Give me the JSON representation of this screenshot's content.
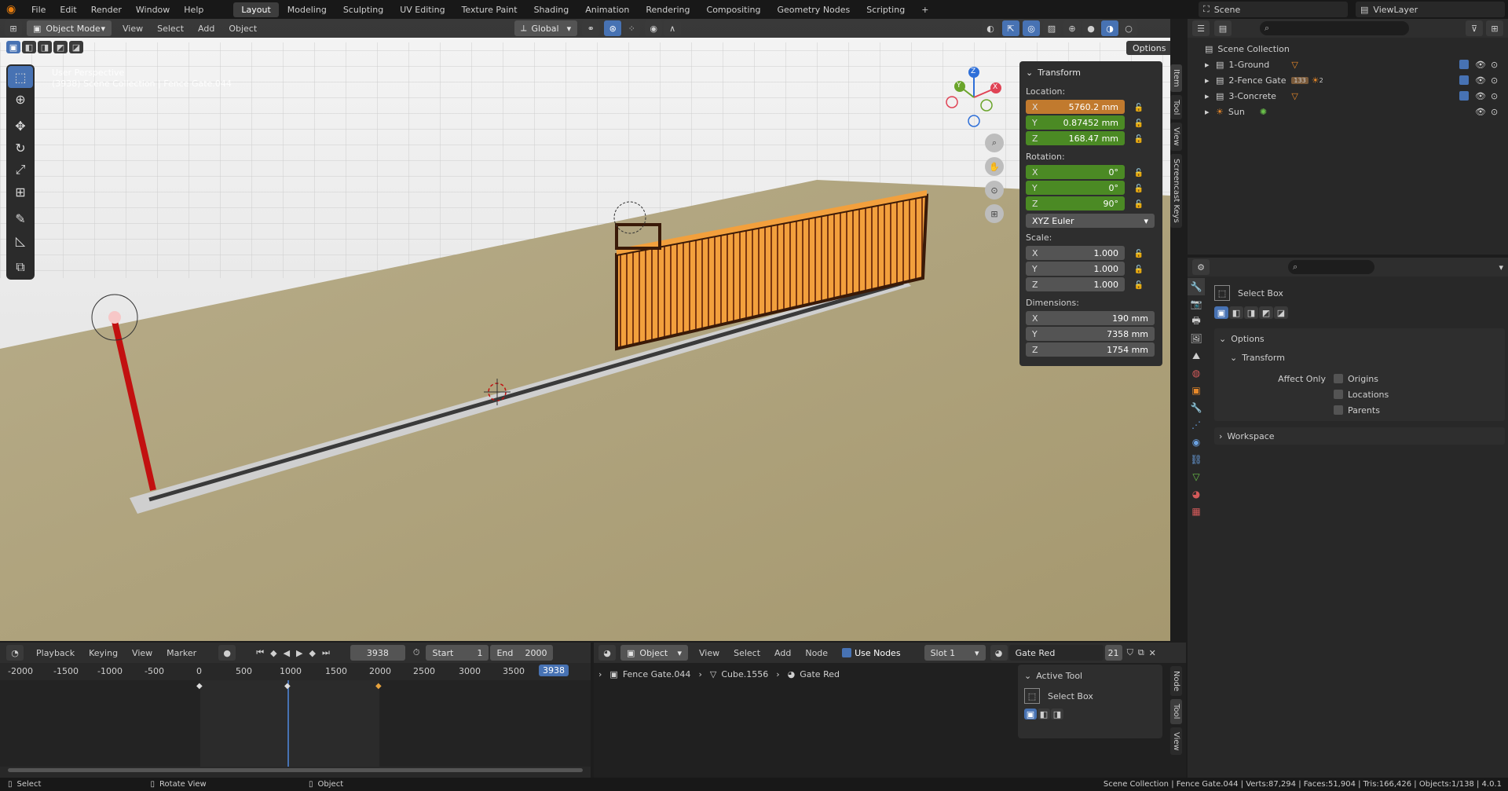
{
  "topbar": {
    "menus": [
      "File",
      "Edit",
      "Render",
      "Window",
      "Help"
    ],
    "tabs": [
      "Layout",
      "Modeling",
      "Sculpting",
      "UV Editing",
      "Texture Paint",
      "Shading",
      "Animation",
      "Rendering",
      "Compositing",
      "Geometry Nodes",
      "Scripting"
    ],
    "active_tab": "Layout",
    "add_tab": "+",
    "scene": "Scene",
    "view_layer": "ViewLayer"
  },
  "viewport": {
    "mode": "Object Mode",
    "menus": [
      "View",
      "Select",
      "Add",
      "Object"
    ],
    "orientation": "Global",
    "options": "Options",
    "overlay_line1": "User Perspective",
    "overlay_line2": "(3938) Scene Collection | Fence Gate.044",
    "gizmo": {
      "x": "X",
      "y": "Y",
      "z": "Z"
    }
  },
  "npanel": {
    "title": "Transform",
    "location_label": "Location:",
    "location": [
      {
        "ax": "X",
        "val": "5760.2 mm"
      },
      {
        "ax": "Y",
        "val": "0.87452 mm"
      },
      {
        "ax": "Z",
        "val": "168.47 mm"
      }
    ],
    "rotation_label": "Rotation:",
    "rotation": [
      {
        "ax": "X",
        "val": "0°"
      },
      {
        "ax": "Y",
        "val": "0°"
      },
      {
        "ax": "Z",
        "val": "90°"
      }
    ],
    "rotation_mode": "XYZ Euler",
    "scale_label": "Scale:",
    "scale": [
      {
        "ax": "X",
        "val": "1.000"
      },
      {
        "ax": "Y",
        "val": "1.000"
      },
      {
        "ax": "Z",
        "val": "1.000"
      }
    ],
    "dimensions_label": "Dimensions:",
    "dimensions": [
      {
        "ax": "X",
        "val": "190 mm"
      },
      {
        "ax": "Y",
        "val": "7358 mm"
      },
      {
        "ax": "Z",
        "val": "1754 mm"
      }
    ],
    "side_tabs": [
      "Item",
      "Tool",
      "View",
      "Screencast Keys"
    ]
  },
  "outliner": {
    "root": "Scene Collection",
    "items": [
      {
        "name": "1-Ground"
      },
      {
        "name": "2-Fence Gate",
        "badge": "133",
        "badge2": "2"
      },
      {
        "name": "3-Concrete"
      },
      {
        "name": "Sun"
      }
    ]
  },
  "properties": {
    "tool_name": "Select Box",
    "options": "Options",
    "transform": "Transform",
    "affect_only": "Affect Only",
    "origins": "Origins",
    "locations": "Locations",
    "parents": "Parents",
    "workspace": "Workspace"
  },
  "timeline": {
    "menus": [
      "Playback",
      "Keying",
      "View",
      "Marker"
    ],
    "current_frame": "3938",
    "start_label": "Start",
    "start": "1",
    "end_label": "End",
    "end": "2000",
    "ticks": [
      "-2000",
      "-1500",
      "-1000",
      "-500",
      "0",
      "500",
      "1000",
      "1500",
      "2000",
      "2500",
      "3000",
      "3500"
    ],
    "playhead": "3938"
  },
  "shader": {
    "object": "Object",
    "menus": [
      "View",
      "Select",
      "Add",
      "Node"
    ],
    "use_nodes": "Use Nodes",
    "slot": "Slot 1",
    "material": "Gate Red",
    "users": "21",
    "breadcrumb": [
      "Fence Gate.044",
      "Cube.1556",
      "Gate Red"
    ],
    "active_tool": "Active Tool",
    "tool_name": "Select Box",
    "side_tabs": [
      "Node",
      "Tool",
      "View"
    ]
  },
  "statusbar": {
    "select": "Select",
    "rotate": "Rotate View",
    "object": "Object",
    "stats": "Scene Collection | Fence Gate.044 | Verts:87,294 | Faces:51,904 | Tris:166,426 | Objects:1/138 | 4.0.1"
  },
  "colors": {
    "accent": "#4772b3",
    "loc_highlight": "#c17a2e",
    "anim_green": "#4b8a24",
    "gate_orange": "#e8892a"
  }
}
